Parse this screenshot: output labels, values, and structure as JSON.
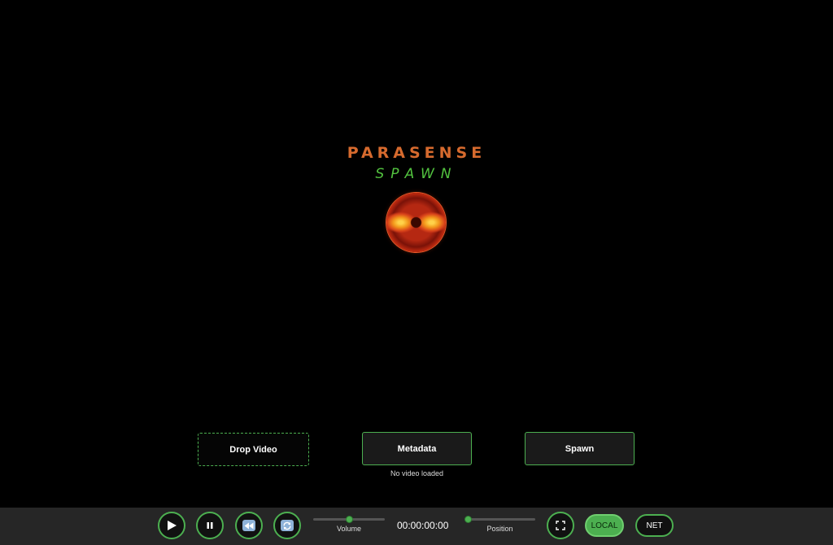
{
  "logo": {
    "title": "PARASENSE",
    "subtitle": "SPAWN"
  },
  "actions": {
    "drop_label": "Drop Video",
    "metadata_label": "Metadata",
    "spawn_label": "Spawn",
    "status_text": "No video loaded"
  },
  "controls": {
    "play_icon": "play-icon",
    "pause_icon": "pause-icon",
    "rewind_icon": "rewind-icon",
    "loop_icon": "loop-icon",
    "volume_label": "Volume",
    "volume_level": 0.5,
    "timecode": "00:00:00:00",
    "position_label": "Position",
    "position_level": 0.0,
    "fullscreen_icon": "fullscreen-icon",
    "local_label": "LOCAL",
    "net_label": "NET",
    "active_mode": "LOCAL"
  },
  "colors": {
    "accent": "#4caf50",
    "title": "#d66a2e",
    "subtitle": "#52c23f",
    "background": "#000000",
    "controlbar": "#262626"
  }
}
